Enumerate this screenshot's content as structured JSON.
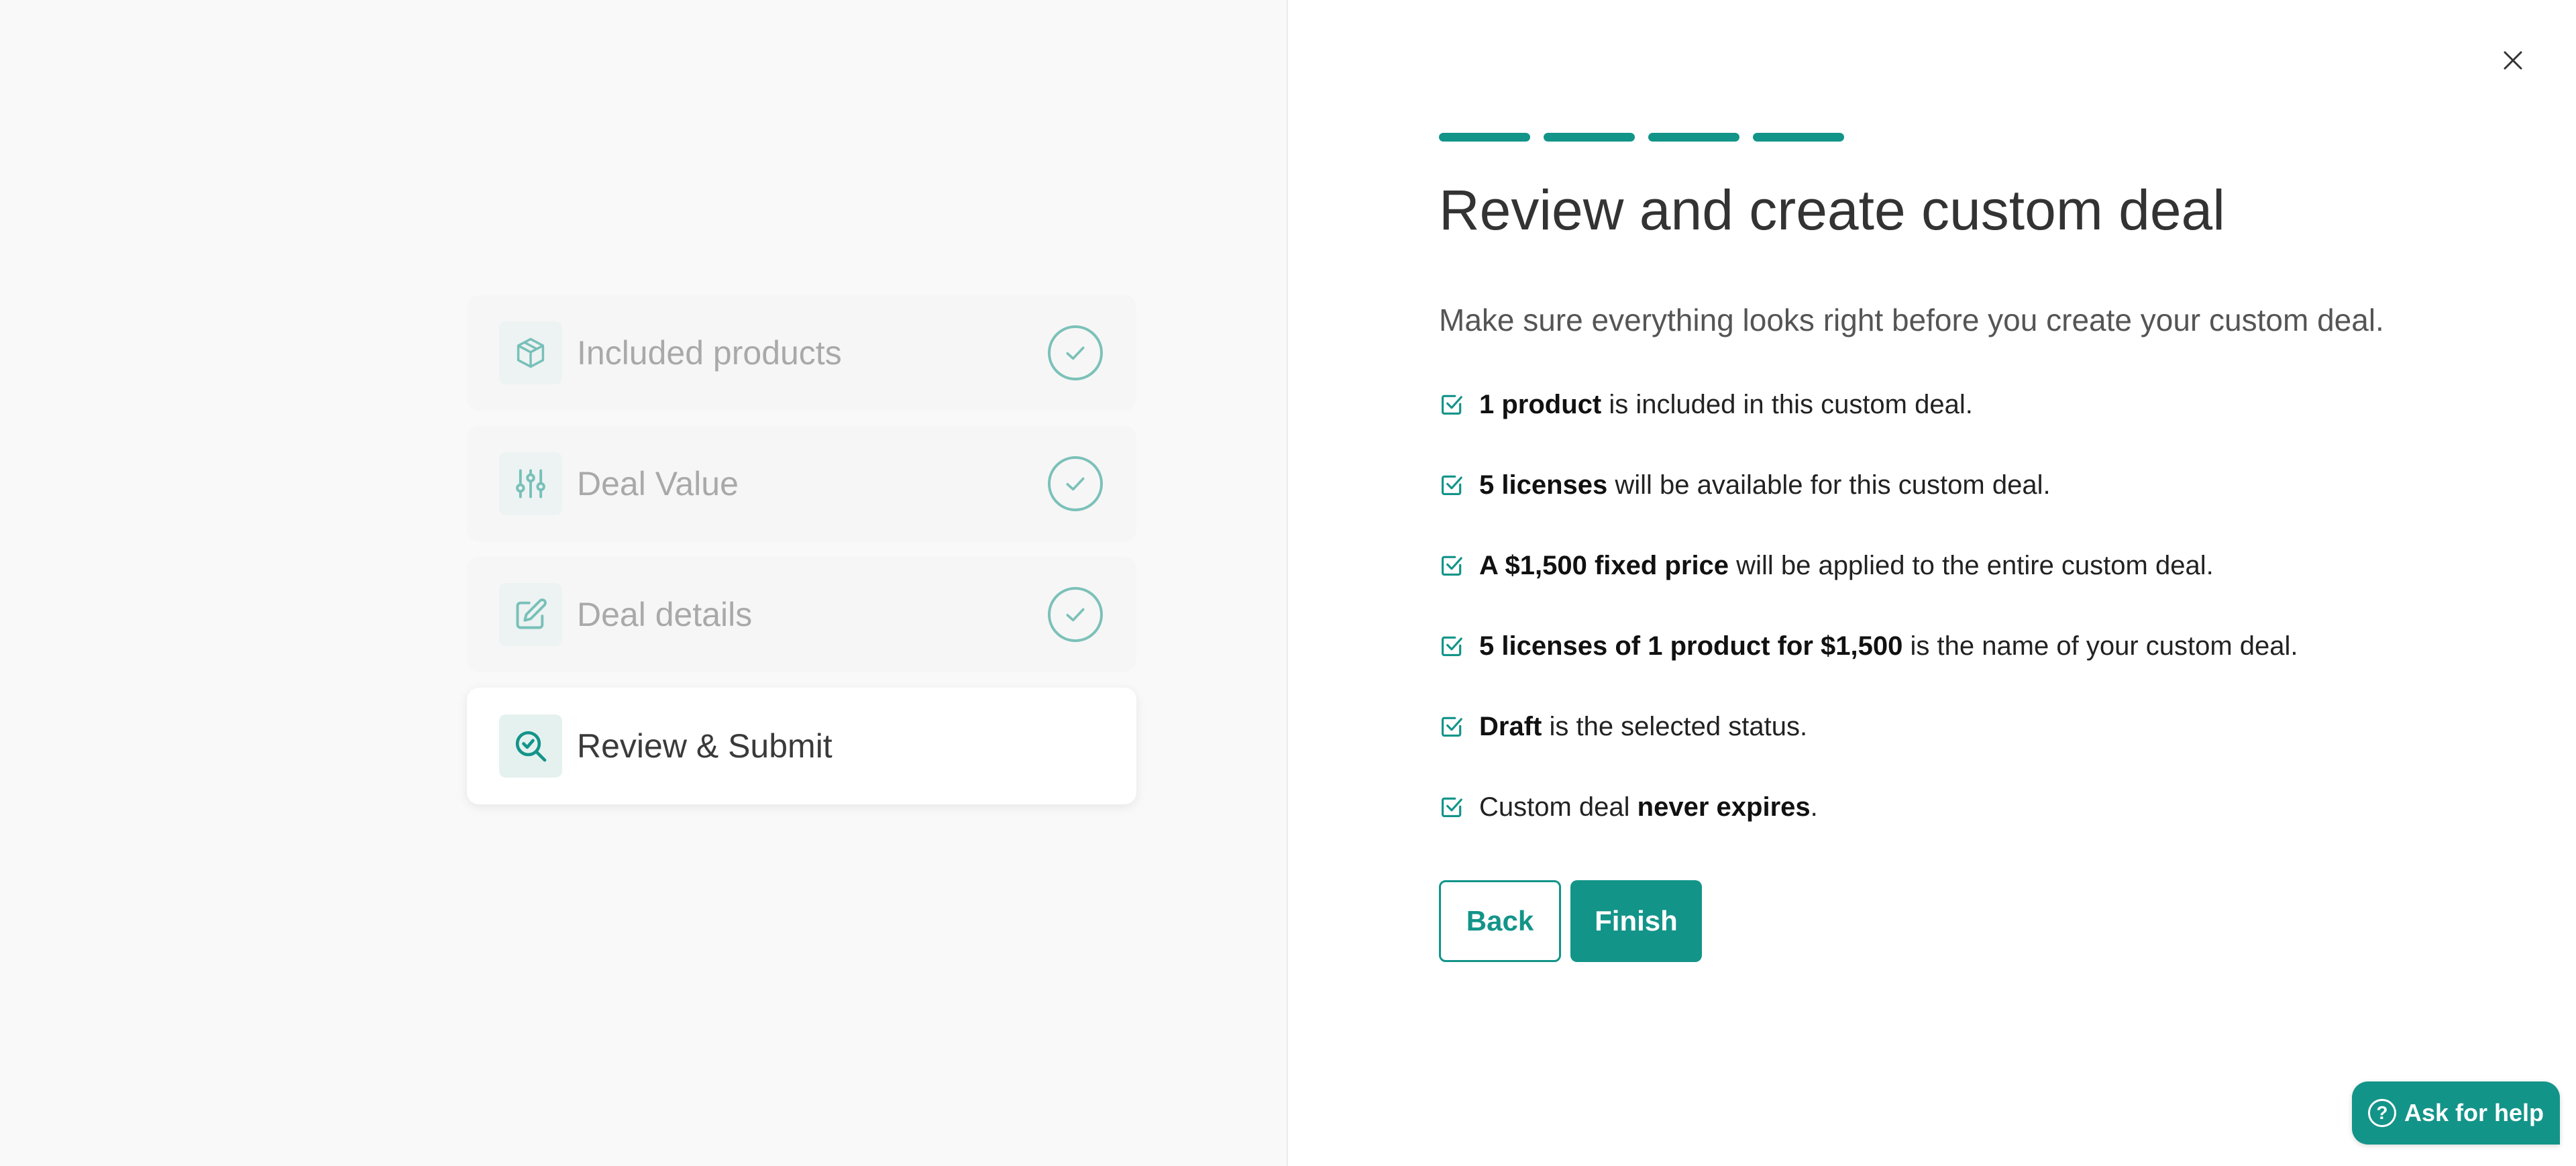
{
  "steps": [
    {
      "label": "Included products",
      "icon": "package-icon",
      "state": "done"
    },
    {
      "label": "Deal Value",
      "icon": "sliders-icon",
      "state": "done"
    },
    {
      "label": "Deal details",
      "icon": "edit-icon",
      "state": "done"
    },
    {
      "label": "Review & Submit",
      "icon": "search-check-icon",
      "state": "active"
    }
  ],
  "progress": {
    "total_segments": 4,
    "completed": 4
  },
  "main": {
    "title": "Review and create custom deal",
    "subtitle": "Make sure everything looks right before you create your custom deal.",
    "checklist": [
      {
        "bold": "1 product",
        "rest": " is included in this custom deal."
      },
      {
        "bold": "5 licenses",
        "rest": " will be available for this custom deal."
      },
      {
        "bold": "A $1,500 fixed price",
        "rest": " will be applied to the entire custom deal."
      },
      {
        "bold": "5 licenses of 1 product for $1,500",
        "rest": " is the name of your custom deal."
      },
      {
        "bold": "Draft",
        "rest": " is the selected status."
      },
      {
        "prefix": "Custom deal ",
        "bold": "never expires",
        "suffix": "."
      }
    ]
  },
  "buttons": {
    "back_label": "Back",
    "finish_label": "Finish"
  },
  "help": {
    "label": "Ask for help",
    "icon_glyph": "?"
  },
  "colors": {
    "accent": "#139489",
    "step_icon_bg": "#e4f1ef",
    "check_ring": "#7bc1b9"
  }
}
